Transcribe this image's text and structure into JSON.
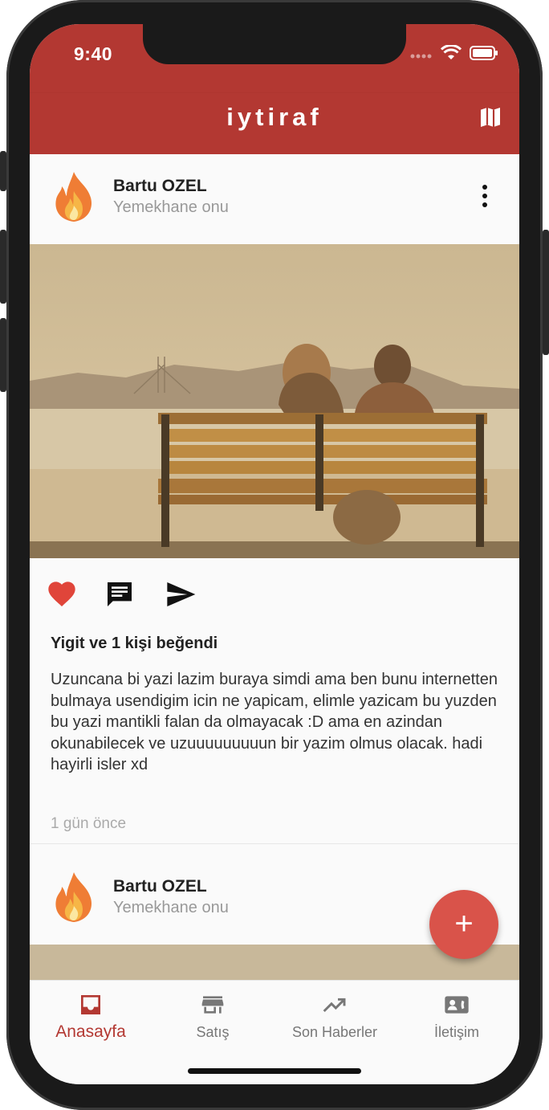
{
  "status_bar": {
    "time": "9:40"
  },
  "app_bar": {
    "title": "iytiraf",
    "map_icon": "map-icon"
  },
  "posts": [
    {
      "author": "Bartu OZEL",
      "location": "Yemekhane onu",
      "likes_text": "Yigit ve 1 kişi beğendi",
      "caption": "Uzuncana bi yazi lazim buraya simdi ama ben bunu internetten bulmaya usendigim icin ne yapicam, elimle yazicam bu yuzden bu yazi mantikli falan da olmayacak :D ama en azindan okunabilecek ve uzuuuuuuuuun bir yazim olmus olacak. hadi hayirli isler xd",
      "time_ago": "1 gün önce"
    },
    {
      "author": "Bartu OZEL",
      "location": "Yemekhane onu"
    }
  ],
  "fab": {
    "label": "+"
  },
  "bottom_nav": [
    {
      "label": "Anasayfa",
      "icon": "inbox-icon",
      "active": true
    },
    {
      "label": "Satış",
      "icon": "store-icon",
      "active": false
    },
    {
      "label": "Son Haberler",
      "icon": "trending-up-icon",
      "active": false
    },
    {
      "label": "İletişim",
      "icon": "contact-card-icon",
      "active": false
    }
  ],
  "colors": {
    "primary": "#b33832",
    "accent": "#d9534a",
    "like": "#e0453a"
  }
}
